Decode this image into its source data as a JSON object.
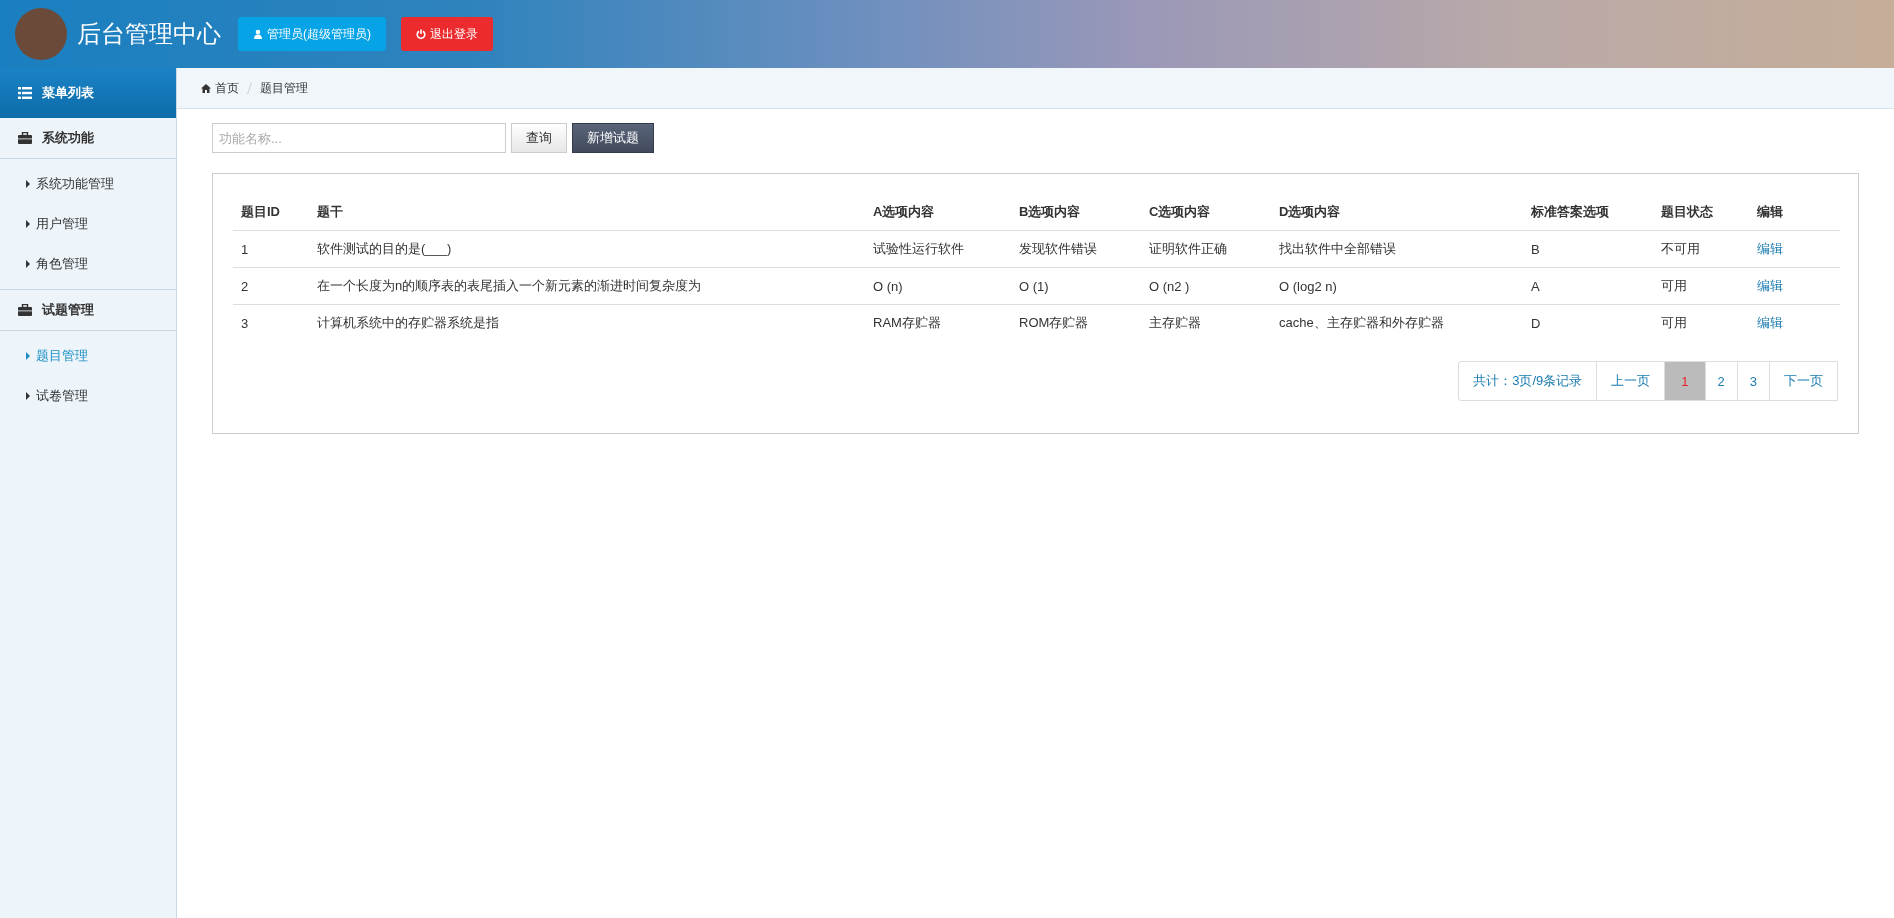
{
  "header": {
    "title": "后台管理中心",
    "user_button": "管理员(超级管理员)",
    "logout_button": "退出登录"
  },
  "sidebar": {
    "title": "菜单列表",
    "groups": [
      {
        "label": "系统功能",
        "items": [
          {
            "label": "系统功能管理",
            "selected": false
          },
          {
            "label": "用户管理",
            "selected": false
          },
          {
            "label": "角色管理",
            "selected": false
          }
        ]
      },
      {
        "label": "试题管理",
        "items": [
          {
            "label": "题目管理",
            "selected": true
          },
          {
            "label": "试卷管理",
            "selected": false
          }
        ]
      }
    ]
  },
  "breadcrumb": [
    "首页",
    "题目管理"
  ],
  "toolbar": {
    "search": {
      "placeholder": "功能名称..."
    },
    "query_button": "查询",
    "add_button": "新增试题"
  },
  "table": {
    "columns": [
      "题目ID",
      "题干",
      "A选项内容",
      "B选项内容",
      "C选项内容",
      "D选项内容",
      "标准答案选项",
      "题目状态",
      "编辑"
    ],
    "rows": [
      {
        "cells": [
          "1",
          "软件测试的目的是(___)",
          "试验性运行软件",
          "发现软件错误",
          "证明软件正确",
          "找出软件中全部错误",
          "B",
          "不可用"
        ],
        "action": "编辑"
      },
      {
        "cells": [
          "2",
          "在一个长度为n的顺序表的表尾插入一个新元素的渐进时间复杂度为",
          "O (n)",
          "O (1)",
          "O (n2 )",
          "O (log2 n)",
          "A",
          "可用"
        ],
        "action": "编辑"
      },
      {
        "cells": [
          "3",
          "计算机系统中的存贮器系统是指",
          "RAM存贮器",
          "ROM存贮器",
          "主存贮器",
          "cache、主存贮器和外存贮器",
          "D",
          "可用"
        ],
        "action": "编辑"
      }
    ]
  },
  "pagination": {
    "summary": "共计：3页/9条记录",
    "prev": "上一页",
    "pages": [
      {
        "label": "1",
        "selected": true
      },
      {
        "label": "2",
        "selected": false
      },
      {
        "label": "3",
        "selected": false
      }
    ],
    "next": "下一页"
  }
}
